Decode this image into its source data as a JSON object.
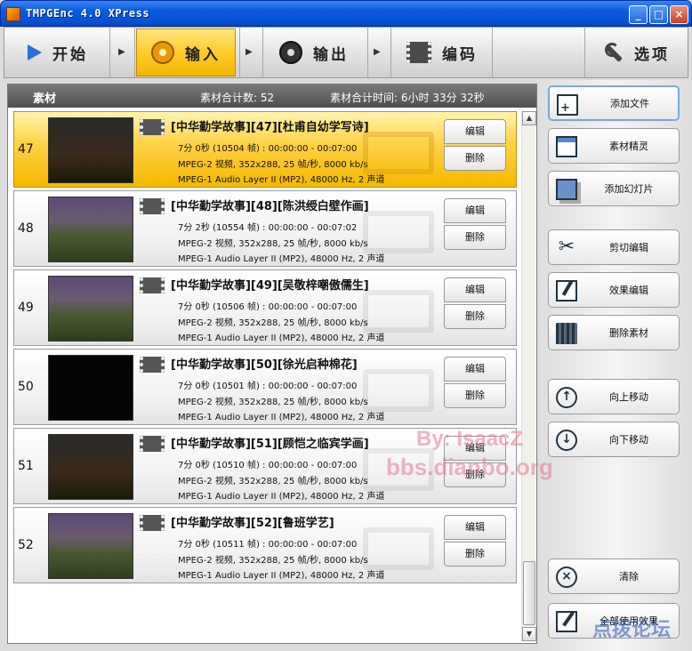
{
  "window": {
    "title": "TMPGEnc 4.0 XPress"
  },
  "nav": {
    "start": "开始",
    "input": "输入",
    "output": "输出",
    "encode": "编码",
    "options": "选项"
  },
  "header": {
    "label": "素材",
    "count": "素材合计数: 52",
    "time": "素材合计时间: 6小时 33分 32秒"
  },
  "rows": [
    {
      "num": "47",
      "title": "[中华勤学故事][47][杜甫自幼学写诗]",
      "line1": "7分 0秒 (10504 帧) : 00:00:00 - 00:07:00",
      "line2": "MPEG-2 视频, 352x288, 25 帧/秒, 8000 kb/s",
      "line3": "MPEG-1 Audio Layer II (MP2), 48000 Hz, 2 声道",
      "edit": "编辑",
      "delete": "删除"
    },
    {
      "num": "48",
      "title": "[中华勤学故事][48][陈洪绶白壁作画]",
      "line1": "7分 2秒 (10554 帧) : 00:00:00 - 00:07:02",
      "line2": "MPEG-2 视频, 352x288, 25 帧/秒, 8000 kb/s",
      "line3": "MPEG-1 Audio Layer II (MP2), 48000 Hz, 2 声道",
      "edit": "编辑",
      "delete": "删除"
    },
    {
      "num": "49",
      "title": "[中华勤学故事][49][吴敬梓嘲傲儒生]",
      "line1": "7分 0秒 (10506 帧) : 00:00:00 - 00:07:00",
      "line2": "MPEG-2 视频, 352x288, 25 帧/秒, 8000 kb/s",
      "line3": "MPEG-1 Audio Layer II (MP2), 48000 Hz, 2 声道",
      "edit": "编辑",
      "delete": "删除"
    },
    {
      "num": "50",
      "title": "[中华勤学故事][50][徐光启种棉花]",
      "line1": "7分 0秒 (10501 帧) : 00:00:00 - 00:07:00",
      "line2": "MPEG-2 视频, 352x288, 25 帧/秒, 8000 kb/s",
      "line3": "MPEG-1 Audio Layer II (MP2), 48000 Hz, 2 声道",
      "edit": "编辑",
      "delete": "删除"
    },
    {
      "num": "51",
      "title": "[中华勤学故事][51][顾恺之临宾学画]",
      "line1": "7分 0秒 (10510 帧) : 00:00:00 - 00:07:00",
      "line2": "MPEG-2 视频, 352x288, 25 帧/秒, 8000 kb/s",
      "line3": "MPEG-1 Audio Layer II (MP2), 48000 Hz, 2 声道",
      "edit": "编辑",
      "delete": "删除"
    },
    {
      "num": "52",
      "title": "[中华勤学故事][52][鲁班学艺]",
      "line1": "7分 0秒 (10511 帧) : 00:00:00 - 00:07:00",
      "line2": "MPEG-2 视频, 352x288, 25 帧/秒, 8000 kb/s",
      "line3": "MPEG-1 Audio Layer II (MP2), 48000 Hz, 2 声道",
      "edit": "编辑",
      "delete": "删除"
    }
  ],
  "side": {
    "add_file": "添加文件",
    "wizard": "素材精灵",
    "add_slideshow": "添加幻灯片",
    "cut_edit": "剪切编辑",
    "effect_edit": "效果编辑",
    "delete_material": "删除素材",
    "move_up": "向上移动",
    "move_down": "向下移动",
    "clear": "清除",
    "apply_all": "全部使用效果"
  },
  "watermarks": {
    "line1": "By: IsaacZ",
    "line2": "bbs.dianbo.org",
    "logo": "点拨论坛"
  }
}
